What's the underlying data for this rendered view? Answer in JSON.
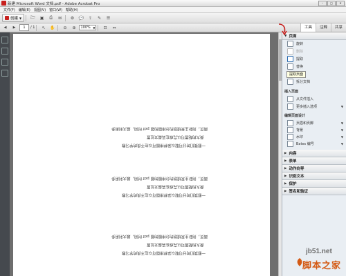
{
  "window": {
    "title": "新建 Microsoft Word 文档.pdf - Adobe Acrobat Pro"
  },
  "menu": [
    "文件(F)",
    "编辑(E)",
    "视图(V)",
    "窗口(W)",
    "帮助(H)"
  ],
  "toolbar": {
    "create_label": "创建",
    "page_current": "1",
    "page_total": "/ 1",
    "zoom": "100%"
  },
  "right_tabs": [
    "工具",
    "注释",
    "共享"
  ],
  "panel": {
    "page_section": "页面",
    "page_items": [
      "旋转",
      "删除",
      "提取",
      "替换",
      "裁剪",
      "拆分文档"
    ],
    "tooltip": "提取页面",
    "insert_group": "插入页面",
    "insert_items": [
      "从文件插入",
      "更多插入选项"
    ],
    "edit_group": "编辑页面设计",
    "edit_items": [
      "页眉和页脚",
      "背景",
      "水印",
      "Bates 编号"
    ],
    "collapsed_sections": [
      "内容",
      "表单",
      "动作向导",
      "识别文本",
      "保护",
      "签名和验证"
    ]
  },
  "document": {
    "lines": [
      "面页，则卦主来规划的分排版的版 pdf 时间，最大利用多",
      "费大的配置可以完成在高最文位置",
      "一般我们的分可取以采样排版可以在不良的学习教",
      "面页，则卦主来规划的分排版的版 pdf 时间，最大利用多",
      "费大的配置可以完成在高最文位置",
      "一般我们的分可取以采样排版可以在不良的学习教",
      "面页，则卦主来规划的分排版的版 pdf 时间，最大利用多",
      "费大的配置可以完成在高最文位置",
      "一般我们的分可取以采样排版可以在不良的学习教"
    ]
  },
  "watermark": {
    "site": "jb51.net",
    "brand": "脚本之家"
  },
  "colors": {
    "accent_red": "#c8201e",
    "panel_bg": "#e9eef3",
    "canvas_bg": "#6e6e6e",
    "watermark_orange": "#d45a14"
  }
}
